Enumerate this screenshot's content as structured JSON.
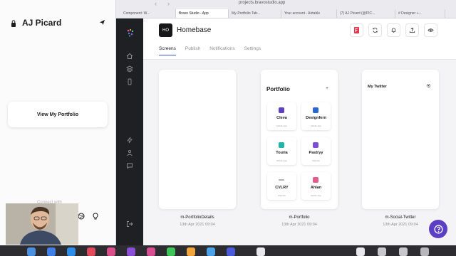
{
  "browser": {
    "url": "projects.bravostudio.app",
    "tabs": [
      {
        "label": "Component: W..."
      },
      {
        "label": "Bravo Studio - App",
        "active": true
      },
      {
        "label": "My-Portfolio Tab..."
      },
      {
        "label": "Your account - Airtable"
      },
      {
        "label": "(7) AJ Picard (@PIC..."
      },
      {
        "label": "# Designer +..."
      }
    ]
  },
  "phone": {
    "title": "AJ Picard",
    "button_label": "View My Portfolio",
    "connect_text": "Connect with"
  },
  "project": {
    "badge": "HO",
    "title": "Homebase",
    "tabs": [
      {
        "label": "Screens",
        "active": true
      },
      {
        "label": "Publish"
      },
      {
        "label": "Notifications"
      },
      {
        "label": "Settings"
      }
    ]
  },
  "toolbar_icons": [
    "figma-icon",
    "sync-icon",
    "bell-icon",
    "upload-icon",
    "eye-icon"
  ],
  "screens": [
    {
      "name": "m-PortfolioDetails",
      "date": "13th Apr 2021 09:04"
    },
    {
      "name": "m-Portfolio",
      "date": "13th Apr 2021 09:04",
      "heading": "Portfolio",
      "plus": "+",
      "tiles": [
        {
          "name": "Cleva",
          "type": "Mobile App",
          "color": "#5b3fc4"
        },
        {
          "name": "Designfern",
          "type": "Mobile App",
          "color": "#2a64d8"
        },
        {
          "name": "Touria",
          "type": "Mobile App",
          "color": "#1fb6a6"
        },
        {
          "name": "Pastryy",
          "type": "Website",
          "color": "#7b4fd6"
        },
        {
          "name": "CVLRY",
          "type": "Website",
          "color": "#b0b0b6"
        },
        {
          "name": "Ahlan",
          "type": "Mobile App",
          "color": "#e85a8c"
        }
      ]
    },
    {
      "name": "m-Social-Twitter",
      "date": "13th Apr 2021 09:04",
      "heading": "My Twitter"
    }
  ],
  "colors": {
    "accent": "#3b5bdb",
    "sidebar": "#1f2024",
    "help": "#5b3fc4"
  }
}
